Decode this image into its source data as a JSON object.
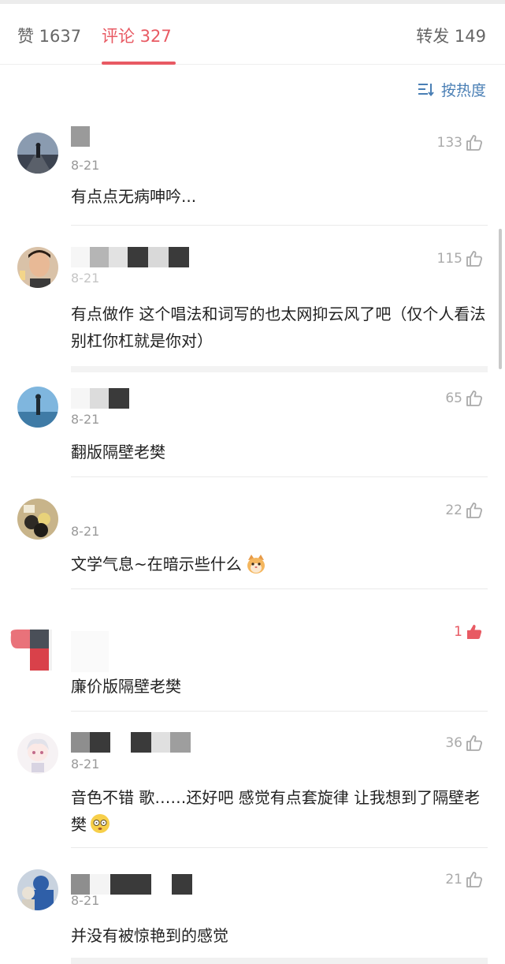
{
  "tabs": {
    "likes": "赞 1637",
    "comments": "评论 327",
    "reposts": "转发 149"
  },
  "sort": {
    "label": "按热度",
    "icon": "sort-icon"
  },
  "colors": {
    "accent": "#e85a63",
    "link": "#4a7fb5",
    "meta": "#999999"
  },
  "comments": [
    {
      "date": "8-21",
      "likes": "133",
      "text": "有点点无病呻吟..."
    },
    {
      "date": "8-21",
      "likes": "115",
      "text": "有点做作 这个唱法和词写的也太网抑云风了吧（仅个人看法 别杠你杠就是你对）"
    },
    {
      "date": "8-21",
      "likes": "65",
      "text": "翻版隔壁老樊"
    },
    {
      "date": "8-21",
      "likes": "22",
      "text": "文学气息~在暗示些什么",
      "emoji": "cat-face-icon"
    },
    {
      "date": "",
      "likes": "1",
      "liked": true,
      "text": "廉价版隔壁老樊"
    },
    {
      "date": "8-21",
      "likes": "36",
      "text": "音色不错 歌……还好吧 感觉有点套旋律 让我想到了隔壁老樊",
      "emoji": "dizzy-face-icon"
    },
    {
      "date": "8-21",
      "likes": "21",
      "text": "并没有被惊艳到的感觉"
    }
  ]
}
